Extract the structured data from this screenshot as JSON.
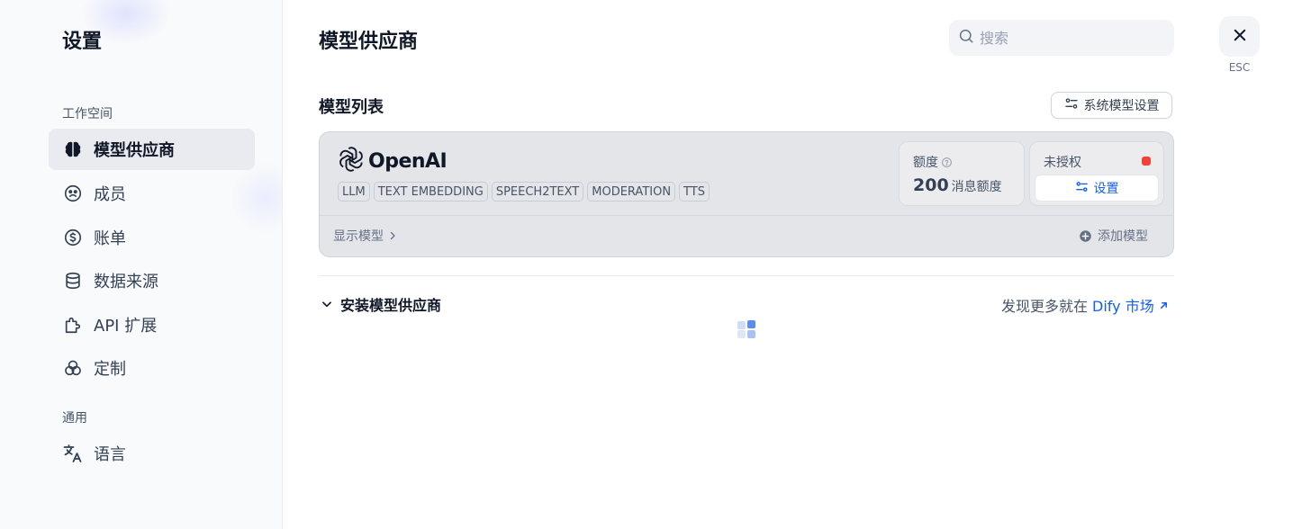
{
  "sidebar": {
    "title": "设置",
    "group_workspace": "工作空间",
    "group_general": "通用",
    "items": [
      {
        "label": "模型供应商",
        "icon": "brain-icon",
        "active": true
      },
      {
        "label": "成员",
        "icon": "members-icon"
      },
      {
        "label": "账单",
        "icon": "billing-icon"
      },
      {
        "label": "数据来源",
        "icon": "database-icon"
      },
      {
        "label": "API 扩展",
        "icon": "puzzle-icon"
      },
      {
        "label": "定制",
        "icon": "customize-icon"
      }
    ],
    "general_items": [
      {
        "label": "语言",
        "icon": "translate-icon"
      }
    ]
  },
  "header": {
    "title": "模型供应商",
    "search_placeholder": "搜索",
    "close_hint": "ESC"
  },
  "model_list": {
    "title": "模型列表",
    "system_settings_label": "系统模型设置"
  },
  "provider": {
    "name": "OpenAI",
    "tags": [
      "LLM",
      "TEXT EMBEDDING",
      "SPEECH2TEXT",
      "MODERATION",
      "TTS"
    ],
    "quota_label": "额度",
    "quota_value": "200",
    "quota_unit": "消息额度",
    "auth_status": "未授权",
    "auth_status_color": "#f04438",
    "setup_label": "设置",
    "show_models_label": "显示模型",
    "add_model_label": "添加模型"
  },
  "install": {
    "title": "安装模型供应商",
    "discover_text": "发现更多就在",
    "marketplace_link": "Dify 市场"
  },
  "colors": {
    "accent": "#155eef",
    "active_nav_bg": "#e9ebf0",
    "card_bg": "#e4e5e9"
  }
}
